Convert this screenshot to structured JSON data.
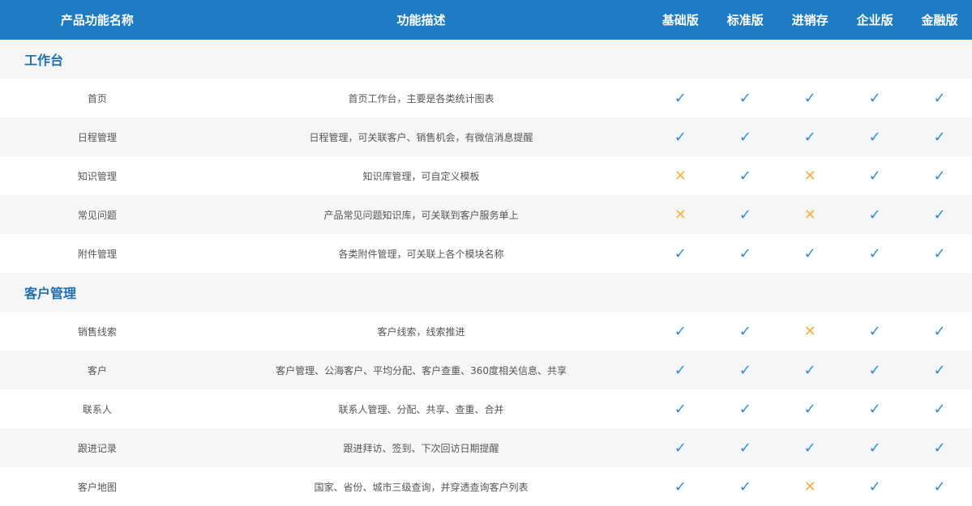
{
  "header": {
    "name": "产品功能名称",
    "desc": "功能描述",
    "versions": [
      "基础版",
      "标准版",
      "进销存",
      "企业版",
      "金融版"
    ]
  },
  "sections": [
    {
      "title": "工作台",
      "rows": [
        {
          "name": "首页",
          "desc": "首页工作台，主要是各类统计图表",
          "marks": [
            "✓",
            "✓",
            "✓",
            "✓",
            "✓"
          ]
        },
        {
          "name": "日程管理",
          "desc": "日程管理，可关联客户、销售机会，有微信消息提醒",
          "marks": [
            "✓",
            "✓",
            "✓",
            "✓",
            "✓"
          ]
        },
        {
          "name": "知识管理",
          "desc": "知识库管理，可自定义模板",
          "marks": [
            "✕",
            "✓",
            "✕",
            "✓",
            "✓"
          ]
        },
        {
          "name": "常见问题",
          "desc": "产品常见问题知识库，可关联到客户服务单上",
          "marks": [
            "✕",
            "✓",
            "✕",
            "✓",
            "✓"
          ]
        },
        {
          "name": "附件管理",
          "desc": "各类附件管理，可关联上各个模块名称",
          "marks": [
            "✓",
            "✓",
            "✓",
            "✓",
            "✓"
          ]
        }
      ]
    },
    {
      "title": "客户管理",
      "rows": [
        {
          "name": "销售线索",
          "desc": "客户线索，线索推进",
          "marks": [
            "✓",
            "✓",
            "✕",
            "✓",
            "✓"
          ]
        },
        {
          "name": "客户",
          "desc": "客户管理、公海客户、平均分配、客户查重、360度相关信息、共享",
          "marks": [
            "✓",
            "✓",
            "✓",
            "✓",
            "✓"
          ]
        },
        {
          "name": "联系人",
          "desc": "联系人管理、分配、共享、查重、合并",
          "marks": [
            "✓",
            "✓",
            "✓",
            "✓",
            "✓"
          ]
        },
        {
          "name": "跟进记录",
          "desc": "跟进拜访、签到、下次回访日期提醒",
          "marks": [
            "✓",
            "✓",
            "✓",
            "✓",
            "✓"
          ]
        },
        {
          "name": "客户地图",
          "desc": "国家、省份、城市三级查询，并穿透查询客户列表",
          "marks": [
            "✓",
            "✓",
            "✕",
            "✓",
            "✓"
          ]
        }
      ]
    }
  ]
}
